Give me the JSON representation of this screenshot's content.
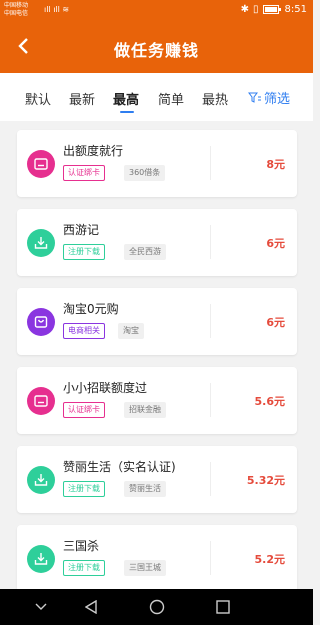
{
  "statusbar": {
    "carrier1": "中国移动",
    "carrier2": "中国电信",
    "time": "8:51"
  },
  "header": {
    "title": "做任务赚钱"
  },
  "tabs": [
    {
      "label": "默认"
    },
    {
      "label": "最新"
    },
    {
      "label": "最高"
    },
    {
      "label": "简单"
    },
    {
      "label": "最热"
    }
  ],
  "filter_label": "筛选",
  "tasks": [
    {
      "title": "出额度就行",
      "tag1": "认证绑卡",
      "tag2": "360借条",
      "reward": "8元",
      "icon": "card-icon"
    },
    {
      "title": "西游记",
      "tag1": "注册下载",
      "tag2": "全民西游",
      "reward": "6元",
      "icon": "download-icon"
    },
    {
      "title": "淘宝0元购",
      "tag1": "电商相关",
      "tag2": "淘宝",
      "reward": "6元",
      "icon": "shopping-bag-icon"
    },
    {
      "title": "小小招联额度过",
      "tag1": "认证绑卡",
      "tag2": "招联金融",
      "reward": "5.6元",
      "icon": "card-icon"
    },
    {
      "title": "赞丽生活（实名认证)",
      "tag1": "注册下载",
      "tag2": "赞丽生活",
      "reward": "5.32元",
      "icon": "download-icon"
    },
    {
      "title": "三国杀",
      "tag1": "注册下载",
      "tag2": "三国王城",
      "reward": "5.2元",
      "icon": "download-icon"
    }
  ],
  "colors": {
    "brand": "#e8630a",
    "accent_blue": "#2f7ef0",
    "reward_red": "#e54b3c",
    "pink": "#e62f8f",
    "green": "#2ecf9a",
    "purple": "#8a35e0"
  }
}
